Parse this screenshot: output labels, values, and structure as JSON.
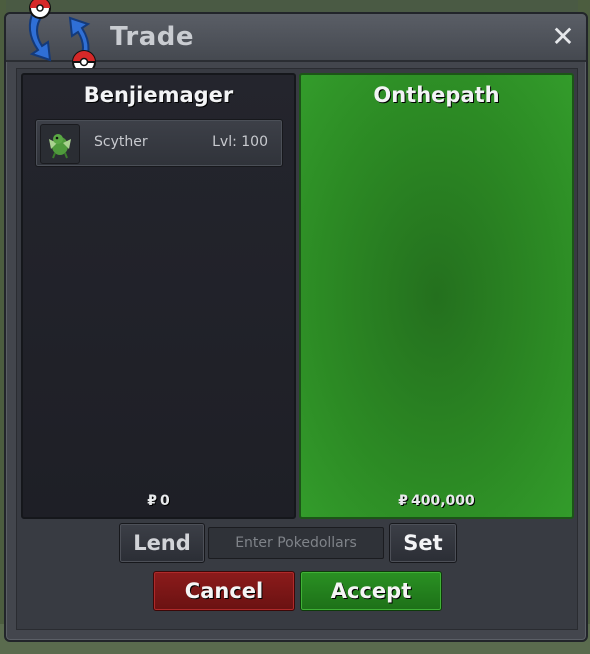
{
  "window": {
    "title": "Trade",
    "close_symbol": "✕"
  },
  "icons": {
    "logo": "pokeball-trade-arrows-icon",
    "close": "close-icon",
    "pokemon": "scyther-sprite-icon",
    "currency": "pokedollar-icon"
  },
  "left_panel": {
    "player_name": "Benjiemager",
    "items": [
      {
        "name": "Scyther",
        "level": "Lvl: 100"
      }
    ],
    "currency_symbol": "₽",
    "money": "0"
  },
  "right_panel": {
    "player_name": "Onthepath",
    "currency_symbol": "₽",
    "money": "400,000"
  },
  "controls": {
    "lend_label": "Lend",
    "money_placeholder": "Enter Pokedollars",
    "set_label": "Set",
    "cancel_label": "Cancel",
    "accept_label": "Accept"
  },
  "colors": {
    "accept_green": "#2a9123",
    "cancel_red": "#8c1b1b",
    "offer_panel_green": "#2c8a24",
    "panel_dark": "#22232b"
  }
}
